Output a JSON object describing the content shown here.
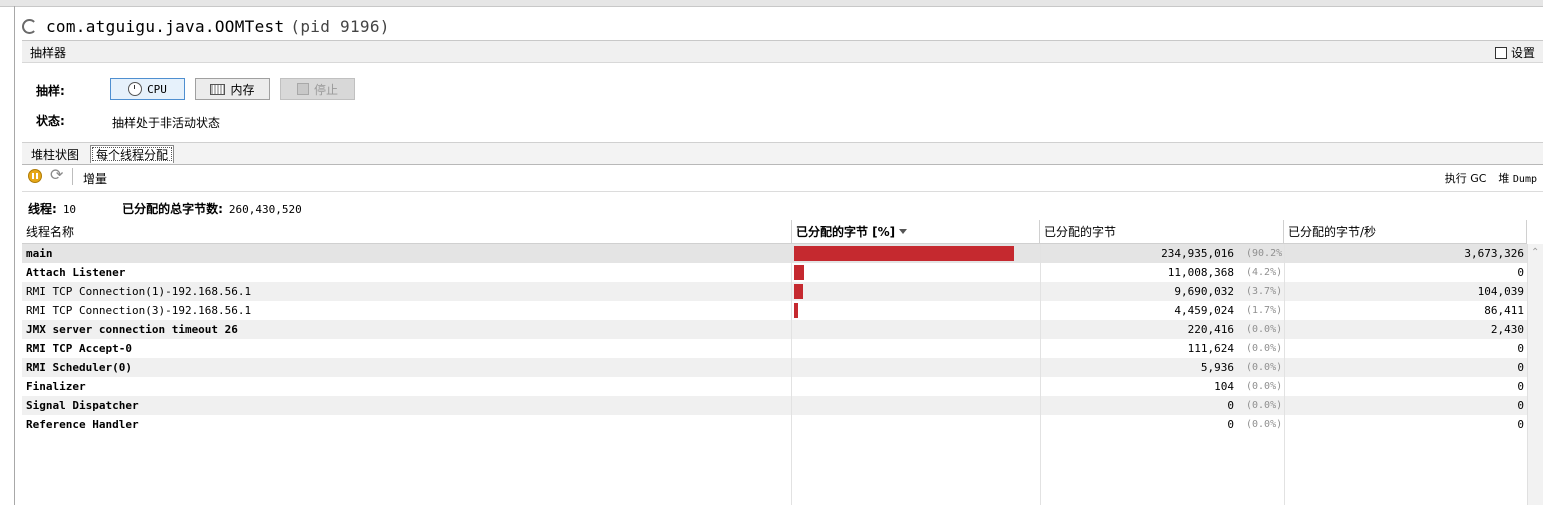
{
  "window": {
    "title": "com.atguigu.java.OOMTest",
    "pid": "(pid 9196)"
  },
  "sampler": {
    "section_label": "抽样器",
    "settings_label": "设置",
    "sample_label": "抽样:",
    "cpu_button": "CPU",
    "memory_button": "内存",
    "stop_button": "停止",
    "status_label": "状态:",
    "status_value": "抽样处于非活动状态"
  },
  "tabs": {
    "heap_histogram": "堆柱状图",
    "per_thread_alloc": "每个线程分配"
  },
  "toolbar": {
    "delta_label": "增量",
    "perform_gc": "执行 GC",
    "heap_dump_prefix": "堆",
    "heap_dump_suffix": "Dump"
  },
  "summary": {
    "threads_label": "线程:",
    "threads_value": "10",
    "total_label": "已分配的总字节数:",
    "total_value": "260,430,520"
  },
  "table": {
    "columns": [
      "线程名称",
      "已分配的字节 [%]",
      "已分配的字节",
      "已分配的字节/秒"
    ],
    "rows": [
      {
        "name": "main",
        "bytes": "234,935,016",
        "pct": "(90.2%)",
        "rate": "3,673,326",
        "fraction": 0.902
      },
      {
        "name": "Attach Listener",
        "bytes": "11,008,368",
        "pct": "(4.2%)",
        "rate": "0",
        "fraction": 0.042
      },
      {
        "name": "RMI TCP Connection(1)-192.168.56.1",
        "bytes": "9,690,032",
        "pct": "(3.7%)",
        "rate": "104,039",
        "fraction": 0.037
      },
      {
        "name": "RMI TCP Connection(3)-192.168.56.1",
        "bytes": "4,459,024",
        "pct": "(1.7%)",
        "rate": "86,411",
        "fraction": 0.017
      },
      {
        "name": "JMX server connection timeout 26",
        "bytes": "220,416",
        "pct": "(0.0%)",
        "rate": "2,430",
        "fraction": 0.0
      },
      {
        "name": "RMI TCP Accept-0",
        "bytes": "111,624",
        "pct": "(0.0%)",
        "rate": "0",
        "fraction": 0.0
      },
      {
        "name": "RMI Scheduler(0)",
        "bytes": "5,936",
        "pct": "(0.0%)",
        "rate": "0",
        "fraction": 0.0
      },
      {
        "name": "Finalizer",
        "bytes": "104",
        "pct": "(0.0%)",
        "rate": "0",
        "fraction": 0.0
      },
      {
        "name": "Signal Dispatcher",
        "bytes": "0",
        "pct": "(0.0%)",
        "rate": "0",
        "fraction": 0.0
      },
      {
        "name": "Reference Handler",
        "bytes": "0",
        "pct": "(0.0%)",
        "rate": "0",
        "fraction": 0.0
      }
    ]
  },
  "colors": {
    "bar": "#c5292f",
    "active_button": "#4f8fd0"
  }
}
